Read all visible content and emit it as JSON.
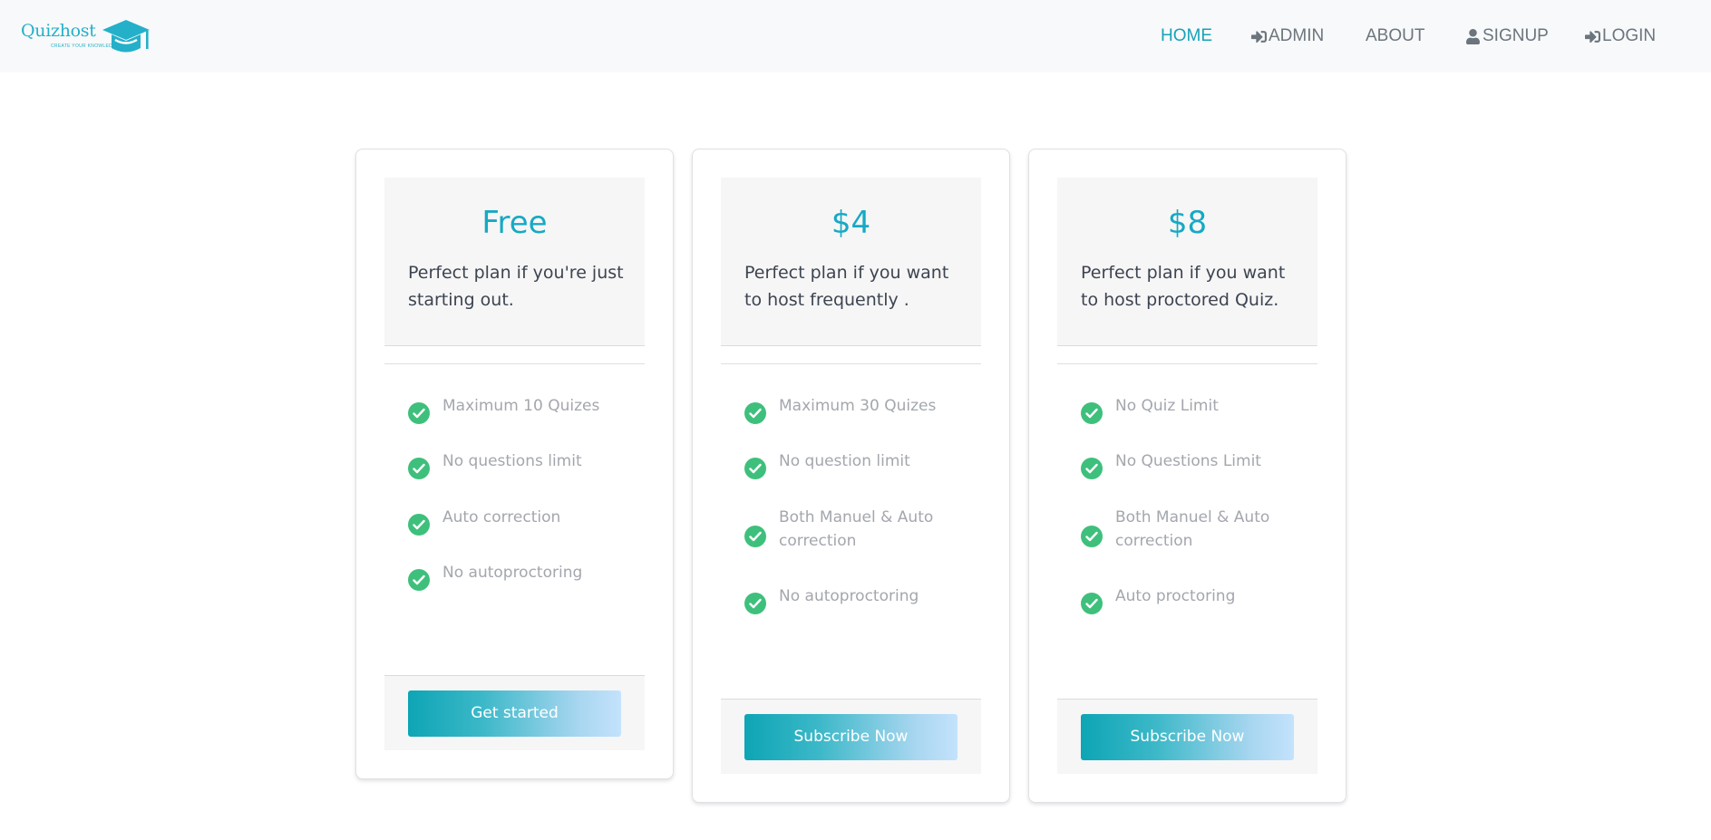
{
  "brand": {
    "name": "Quizhost",
    "tagline": "CREATE YOUR KNOWLEDGE",
    "accent": "#24b0c9"
  },
  "nav": {
    "home": "HOME",
    "admin": "ADMIN",
    "about": "ABOUT",
    "signup": "SIGNUP",
    "login": "LOGIN"
  },
  "plans": [
    {
      "price": "Free",
      "description": "Perfect plan if you're just starting out.",
      "features": [
        "Maximum 10 Quizes",
        "No questions limit",
        "Auto correction",
        "No autoproctoring"
      ],
      "button": "Get started"
    },
    {
      "price": "$4",
      "description": "Perfect plan if you want to host frequently .",
      "features": [
        "Maximum 30 Quizes",
        "No question limit",
        "Both Manuel & Auto correction",
        "No autoproctoring"
      ],
      "button": "Subscribe Now"
    },
    {
      "price": "$8",
      "description": "Perfect plan if you want to host proctored Quiz.",
      "features": [
        "No Quiz Limit",
        "No Questions Limit",
        "Both Manuel & Auto correction",
        "Auto proctoring"
      ],
      "button": "Subscribe Now"
    }
  ],
  "colors": {
    "price": "#17a9c4",
    "check": "#3ec07c",
    "nav_active": "#17a2b8"
  }
}
